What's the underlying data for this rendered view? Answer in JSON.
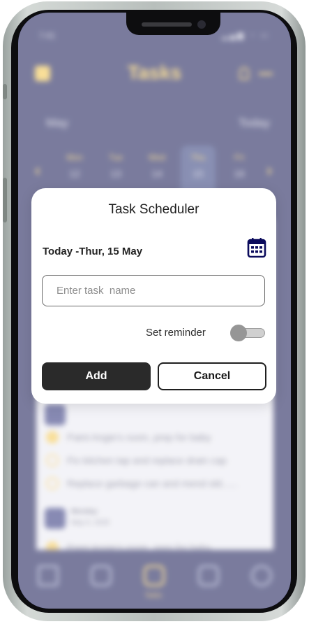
{
  "background_app": {
    "status_time": "7:41",
    "title": "Tasks",
    "month": "May",
    "today": "Today",
    "week": [
      {
        "day": "Mon",
        "date": "12"
      },
      {
        "day": "Tue",
        "date": "13"
      },
      {
        "day": "Wed",
        "date": "14"
      },
      {
        "day": "Thu",
        "date": "15"
      },
      {
        "day": "Fri",
        "date": "16"
      }
    ],
    "tasks_group_1": [
      {
        "text": "Paint Angie's room, prep for baby",
        "done": true
      },
      {
        "text": "Fix kitchen tap and replace drain cap",
        "done": false
      },
      {
        "text": "Replace garbage can and mend old......",
        "done": false
      }
    ],
    "group_2_day": "Monday",
    "group_2_date": "May 5, 2025",
    "tasks_group_2": [
      {
        "text": "Paint Angie's room, prep for baby",
        "done": true
      }
    ],
    "tab_active_label": "Tasks"
  },
  "dialog": {
    "title": "Task Scheduler",
    "date_text": "Today -Thur, 15 May",
    "task_placeholder": "Enter task  name",
    "reminder_label": "Set reminder",
    "reminder_on": false,
    "add_label": "Add",
    "cancel_label": "Cancel"
  },
  "colors": {
    "app_navy": "#000344",
    "accent_yellow": "#f3c13a",
    "button_dark": "#2a2a2a"
  }
}
